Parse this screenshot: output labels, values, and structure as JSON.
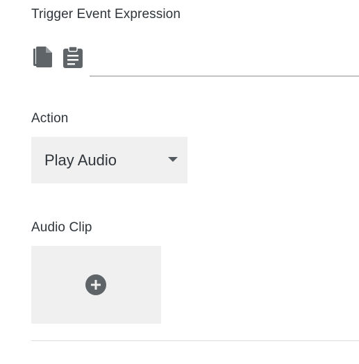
{
  "trigger": {
    "label": "Trigger Event Expression",
    "copy_icon": "copy-icon",
    "paste_icon": "clipboard-icon",
    "expression_value": ""
  },
  "action": {
    "label": "Action",
    "selected": "Play Audio"
  },
  "audio_clip": {
    "label": "Audio Clip",
    "add_icon": "add-circle-icon"
  },
  "colors": {
    "text": "#2f353a",
    "icon": "#5f6468",
    "panel_bg": "#f0f0f0",
    "add_icon_bg": "#5f6468"
  }
}
